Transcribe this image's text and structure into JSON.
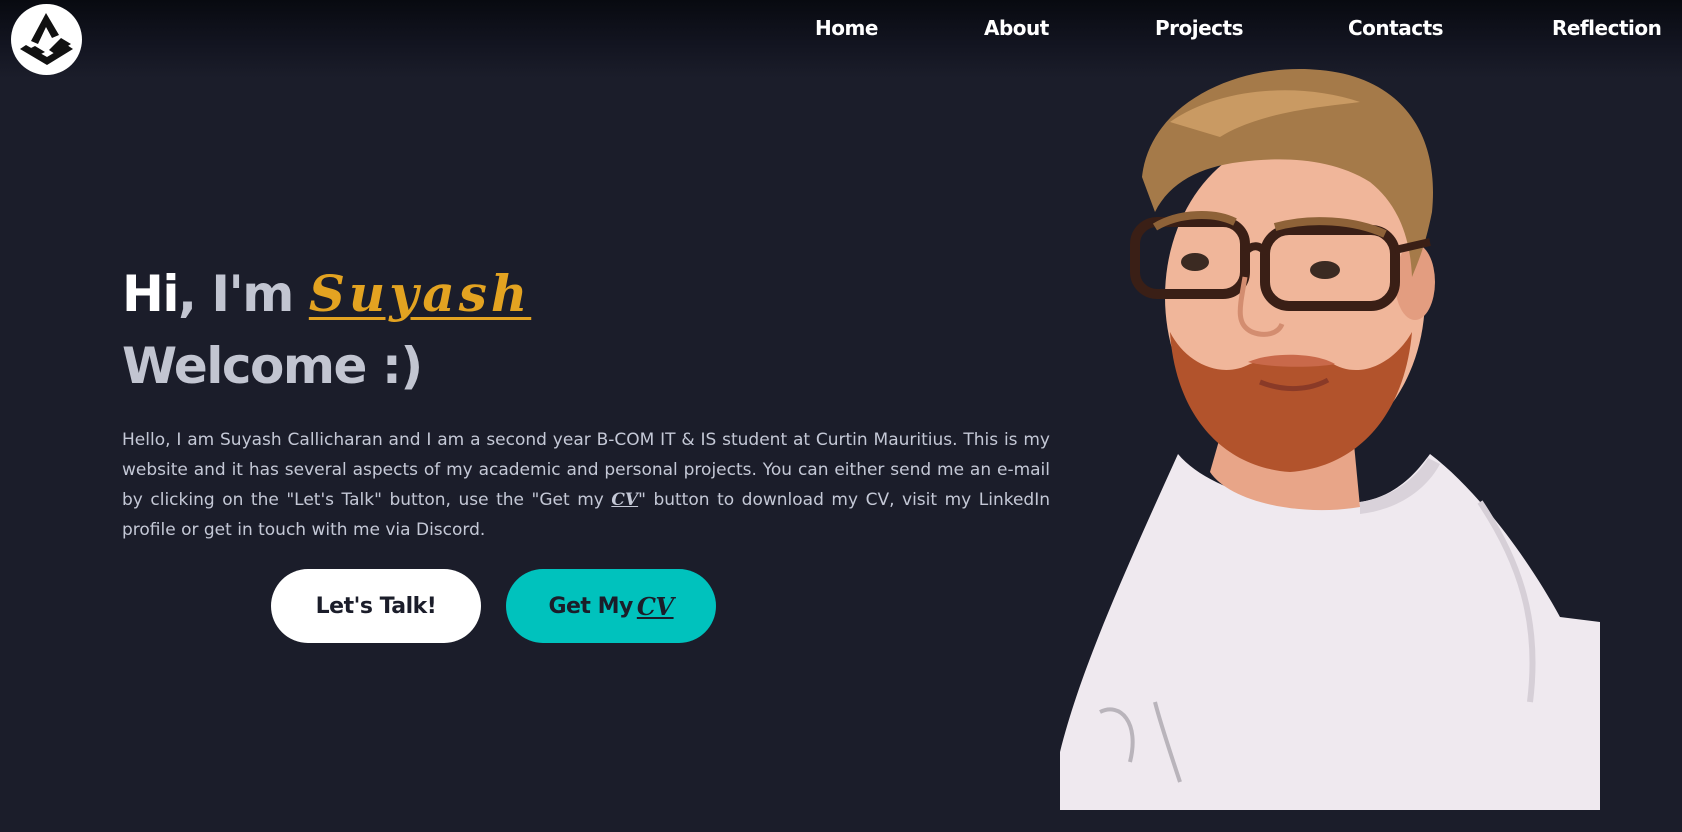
{
  "nav": {
    "links": [
      "Home",
      "About",
      "Projects",
      "Contacts",
      "Reflection"
    ]
  },
  "hero": {
    "greeting_hi": "Hi",
    "greeting_rest": ", I'm ",
    "name": "Suyash",
    "welcome": "Welcome :)",
    "bio_part1": "Hello, I am Suyash Callicharan and I am a second year B-COM IT & IS student at Curtin Mauritius. This is my website and it has several aspects of my academic and personal projects. You can either send me an e-mail by clicking on the \"Let's Talk\" button, use the \"Get my ",
    "bio_cv": "CV",
    "bio_part2": "\" button to download my CV, visit my LinkedIn profile or get in touch with me via Discord."
  },
  "buttons": {
    "talk_label": "Let's Talk!",
    "cv_label": "Get My",
    "cv_emphasis": "CV"
  },
  "colors": {
    "background": "#1b1d2a",
    "accent_name": "#e3a321",
    "accent_cv_button": "#00c2bd",
    "text_muted": "#c4c8d6"
  },
  "icons": {
    "logo": "triangle-cube-logo-icon"
  }
}
